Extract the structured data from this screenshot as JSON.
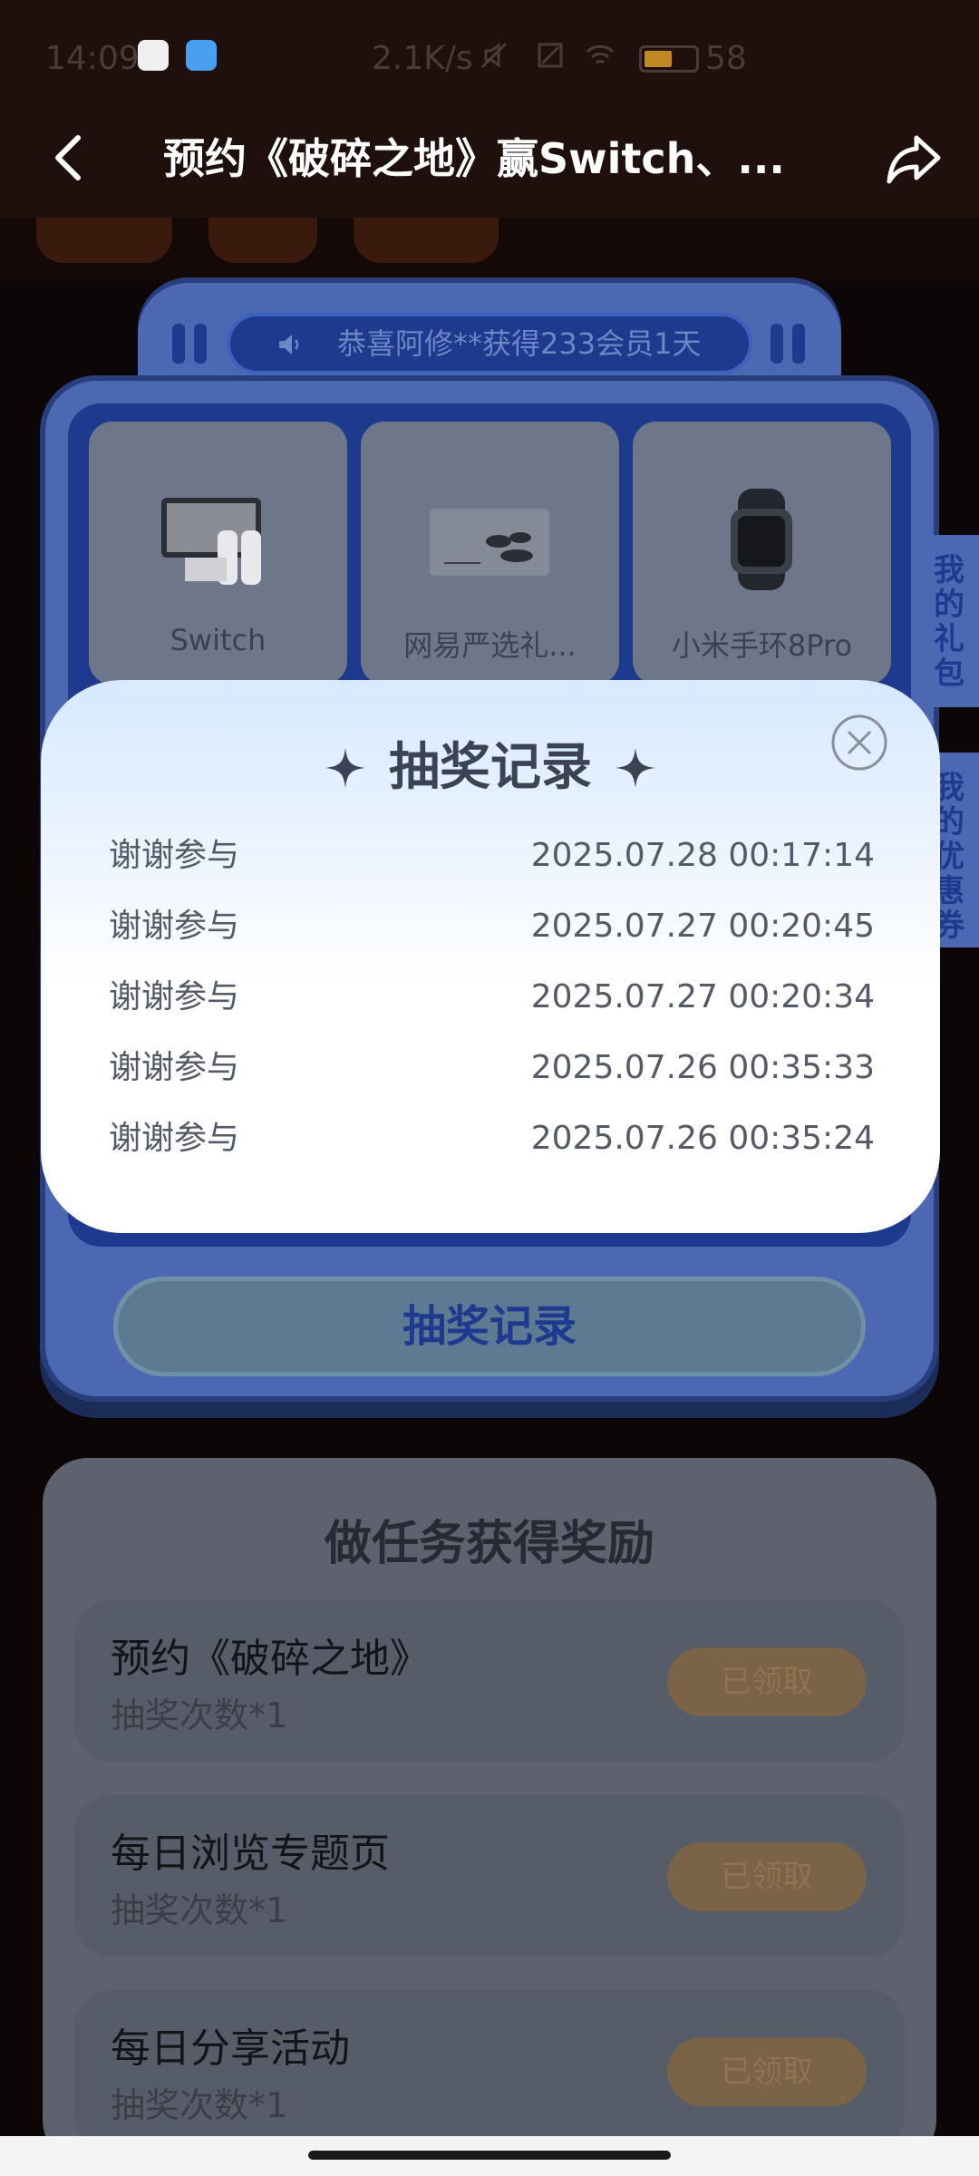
{
  "status_bar": {
    "time": "14:09",
    "net_speed": "2.1K/s",
    "battery": "58"
  },
  "header": {
    "title": "预约《破碎之地》赢Switch、...",
    "back_icon": "back-arrow-icon",
    "share_icon": "share-icon"
  },
  "ticker": {
    "text": "恭喜阿修**获得233会员1天"
  },
  "prizes": [
    {
      "label": "Switch"
    },
    {
      "label": "网易严选礼..."
    },
    {
      "label": "小米手环8Pro"
    }
  ],
  "side_tabs": {
    "gift": "我的礼包",
    "coupon": "我的优惠券"
  },
  "draw_record_button": "抽奖记录",
  "tasks": {
    "title": "做任务获得奖励",
    "items": [
      {
        "name": "预约《破碎之地》",
        "sub": "抽奖次数*1",
        "button": "已领取"
      },
      {
        "name": "每日浏览专题页",
        "sub": "抽奖次数*1",
        "button": "已领取"
      },
      {
        "name": "每日分享活动",
        "sub": "抽奖次数*1",
        "button": "已领取"
      }
    ]
  },
  "modal": {
    "title": "抽奖记录",
    "records": [
      {
        "result": "谢谢参与",
        "time": "2025.07.28 00:17:14"
      },
      {
        "result": "谢谢参与",
        "time": "2025.07.27 00:20:45"
      },
      {
        "result": "谢谢参与",
        "time": "2025.07.27 00:20:34"
      },
      {
        "result": "谢谢参与",
        "time": "2025.07.26 00:35:33"
      },
      {
        "result": "谢谢参与",
        "time": "2025.07.26 00:35:24"
      }
    ]
  },
  "colors": {
    "accent_blue": "#1d3a8f",
    "frame_blue": "#4d68b2",
    "header_bg": "#1f0f0d"
  }
}
